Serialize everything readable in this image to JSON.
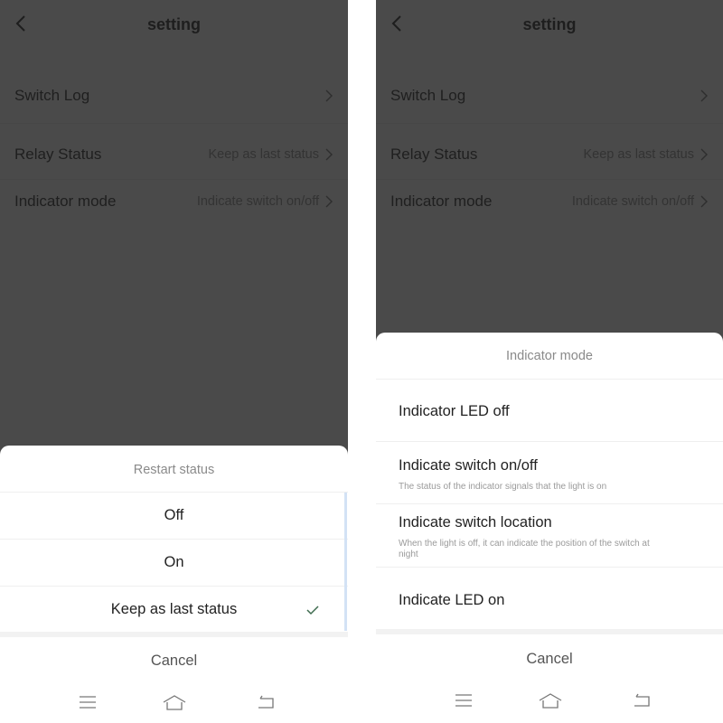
{
  "screens": [
    {
      "header": {
        "title": "setting",
        "back_icon": "chevron-left-icon"
      },
      "settings": [
        {
          "label": "Switch Log",
          "value": ""
        },
        {
          "label": "Relay Status",
          "value": "Keep as last status"
        },
        {
          "label": "Indicator mode",
          "value": "Indicate switch on/off"
        }
      ],
      "sheet": {
        "title": "Restart status",
        "options": [
          {
            "label": "Off",
            "selected": false
          },
          {
            "label": "On",
            "selected": false
          },
          {
            "label": "Keep as last status",
            "selected": true
          }
        ],
        "cancel_label": "Cancel"
      },
      "navbar": [
        "menu-icon",
        "home-icon",
        "back-icon"
      ]
    },
    {
      "header": {
        "title": "setting",
        "back_icon": "chevron-left-icon"
      },
      "settings": [
        {
          "label": "Switch Log",
          "value": ""
        },
        {
          "label": "Relay Status",
          "value": "Keep as last status"
        },
        {
          "label": "Indicator mode",
          "value": "Indicate switch on/off"
        }
      ],
      "sheet": {
        "title": "Indicator mode",
        "options": [
          {
            "label": "Indicator LED off",
            "description": ""
          },
          {
            "label": "Indicate switch on/off",
            "description": "The status of the indicator signals that the light is on"
          },
          {
            "label": "Indicate switch location",
            "description": "When the light is off, it can indicate the position of the switch at night"
          },
          {
            "label": "Indicate LED on",
            "description": ""
          }
        ],
        "cancel_label": "Cancel"
      },
      "navbar": [
        "menu-icon",
        "home-icon",
        "back-icon"
      ]
    }
  ],
  "colors": {
    "overlay": "#4a4a4a",
    "check": "#3e6b4e",
    "scrollbar": "#d3e2f5"
  }
}
